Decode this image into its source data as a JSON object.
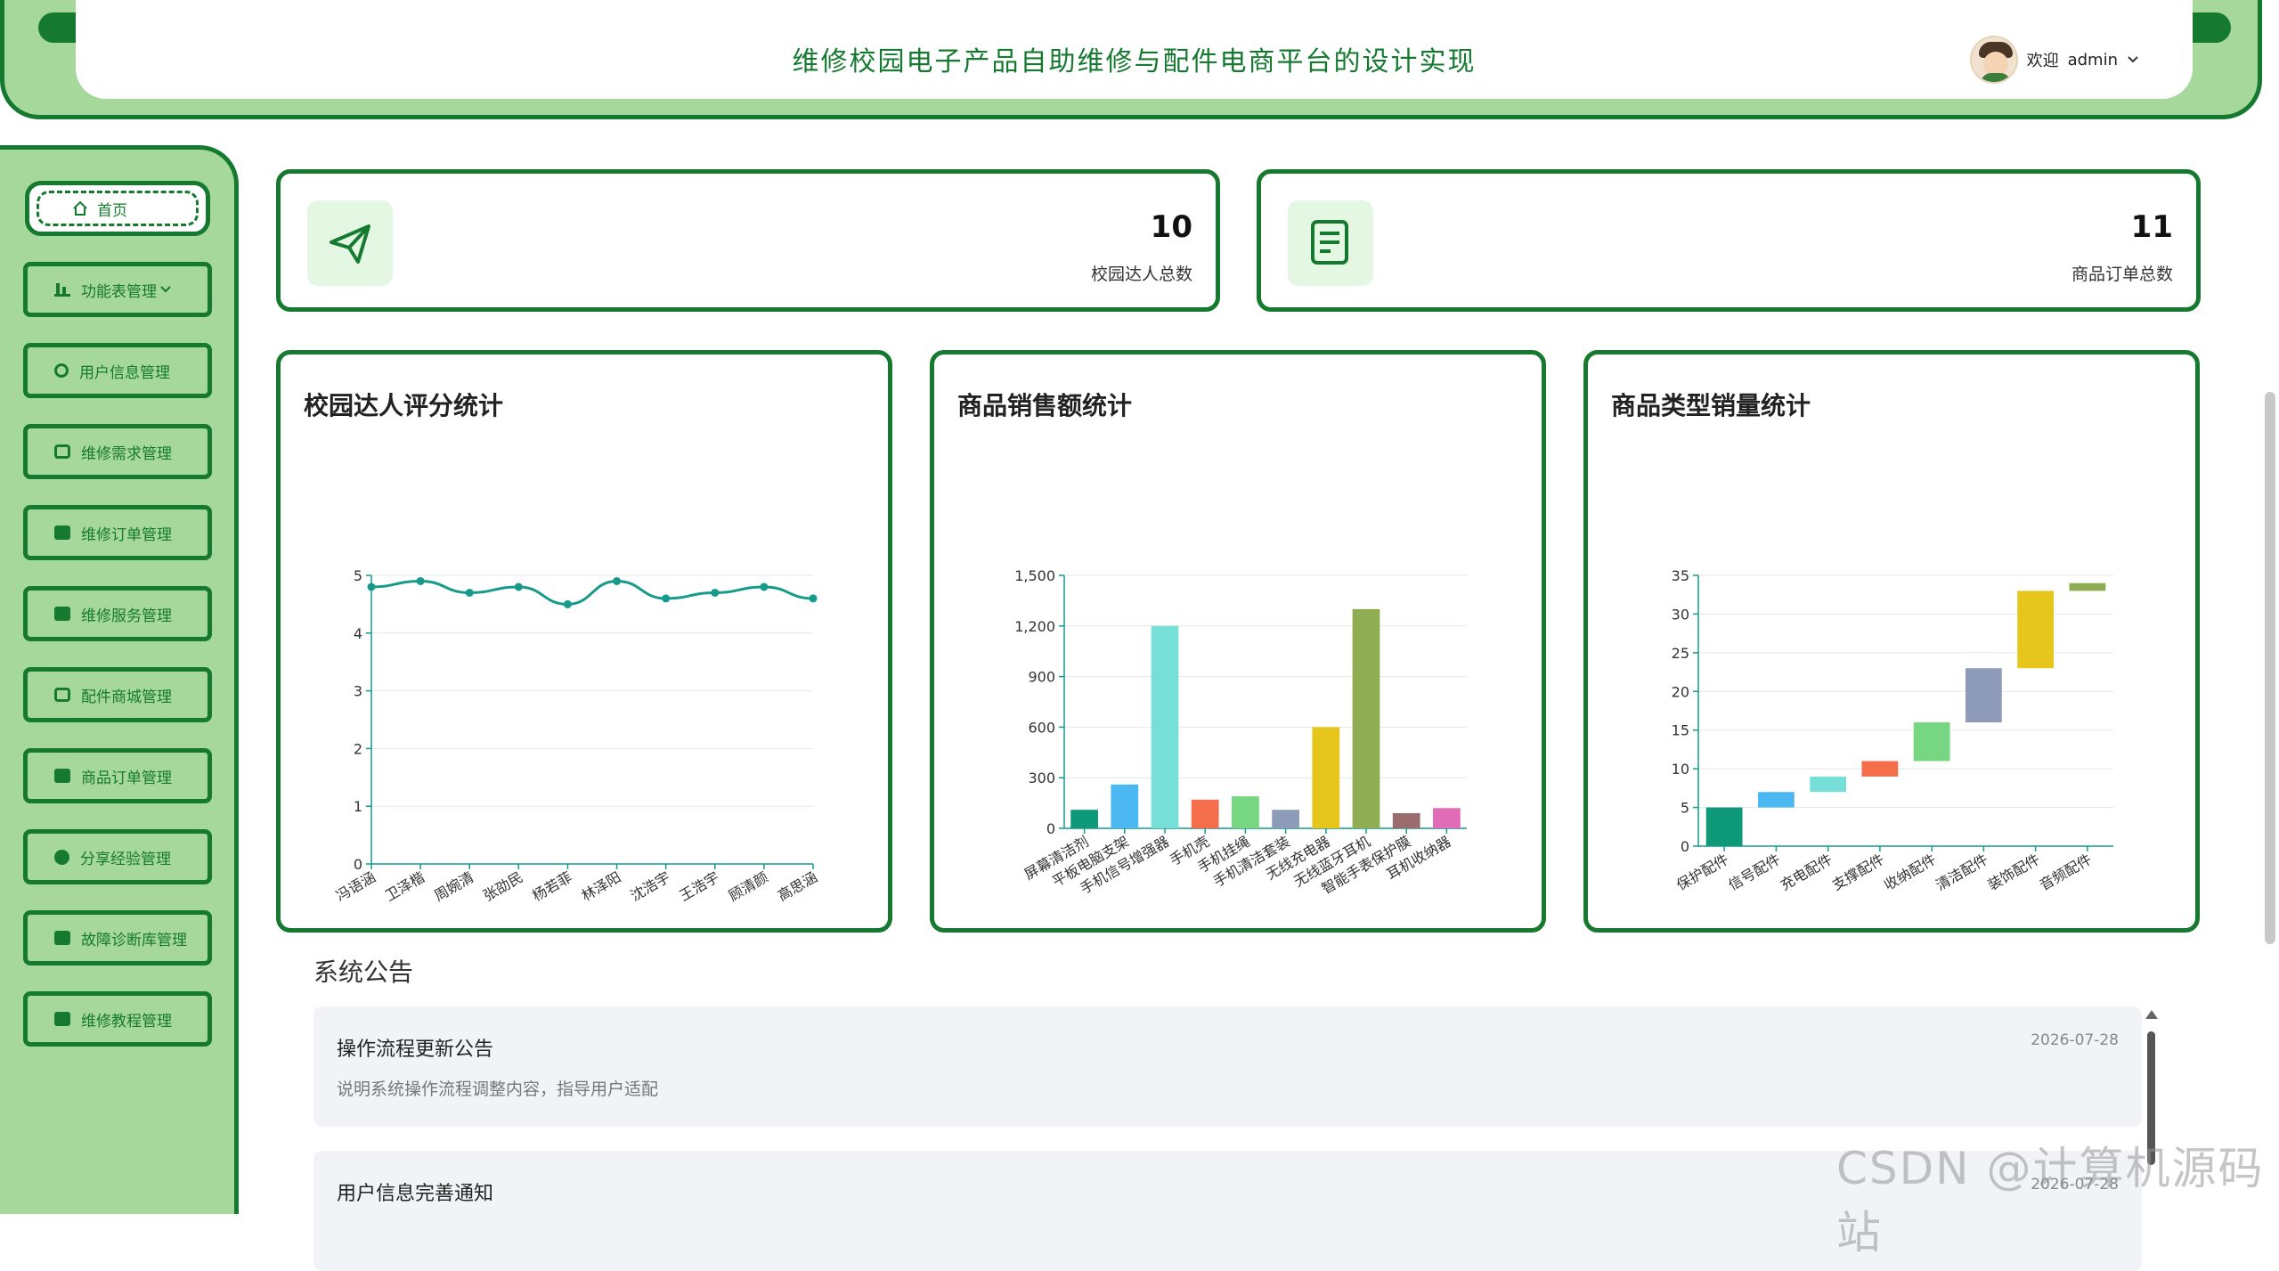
{
  "header": {
    "title": "维修校园电子产品自助维修与配件电商平台的设计实现",
    "welcome": "欢迎",
    "username": "admin"
  },
  "sidebar": {
    "home": "首页",
    "items": [
      {
        "label": "功能表管理",
        "icon": "bar-chart-icon"
      },
      {
        "label": "用户信息管理",
        "icon": "user-icon"
      },
      {
        "label": "维修需求管理",
        "icon": "chip-icon"
      },
      {
        "label": "维修订单管理",
        "icon": "cart-icon"
      },
      {
        "label": "维修服务管理",
        "icon": "folder-icon"
      },
      {
        "label": "配件商城管理",
        "icon": "chip-icon"
      },
      {
        "label": "商品订单管理",
        "icon": "card-icon"
      },
      {
        "label": "分享经验管理",
        "icon": "check-circle-icon"
      },
      {
        "label": "故障诊断库管理",
        "icon": "cart-icon"
      },
      {
        "label": "维修教程管理",
        "icon": "book-icon"
      }
    ]
  },
  "stats": [
    {
      "value": "10",
      "label": "校园达人总数",
      "icon": "send-icon"
    },
    {
      "value": "11",
      "label": "商品订单总数",
      "icon": "document-icon"
    }
  ],
  "chart_titles": [
    "校园达人评分统计",
    "商品销售额统计",
    "商品类型销量统计"
  ],
  "chart_data": [
    {
      "type": "line",
      "title": "校园达人评分统计",
      "categories": [
        "冯语涵",
        "卫泽楷",
        "周婉清",
        "张劭民",
        "杨若菲",
        "林泽阳",
        "沈浩宇",
        "王浩宇",
        "顾清颜",
        "高思涵"
      ],
      "values": [
        4.8,
        4.9,
        4.7,
        4.8,
        4.5,
        4.9,
        4.6,
        4.7,
        4.8,
        4.6
      ],
      "ylim": [
        0,
        5
      ],
      "yticks": [
        "0",
        "1",
        "2",
        "3",
        "4",
        "5"
      ],
      "color": "#159a8c"
    },
    {
      "type": "bar",
      "title": "商品销售额统计",
      "categories": [
        "屏幕清洁剂",
        "平板电脑支架",
        "手机信号增强器",
        "手机壳",
        "手机挂绳",
        "手机清洁套装",
        "无线充电器",
        "无线蓝牙耳机",
        "智能手表保护膜",
        "耳机收纳器"
      ],
      "values": [
        110,
        260,
        1200,
        170,
        190,
        110,
        600,
        1300,
        90,
        120
      ],
      "colors": [
        "#0e9a79",
        "#4cb8f2",
        "#76e0d8",
        "#f56e4c",
        "#76d681",
        "#8e9bb8",
        "#e6c61c",
        "#8fae54",
        "#9a6c6e",
        "#e06bb6"
      ],
      "ylim": [
        0,
        1500
      ],
      "yticks": [
        "0",
        "300",
        "600",
        "900",
        "1,200",
        "1,500"
      ]
    },
    {
      "type": "bar",
      "title": "商品类型销量统计",
      "categories": [
        "保护配件",
        "信号配件",
        "充电配件",
        "支撑配件",
        "收纳配件",
        "清洁配件",
        "装饰配件",
        "音频配件"
      ],
      "ranges": [
        [
          0,
          5
        ],
        [
          5,
          7
        ],
        [
          7,
          9
        ],
        [
          9,
          11
        ],
        [
          11,
          16
        ],
        [
          16,
          23
        ],
        [
          23,
          33
        ],
        [
          33,
          34
        ]
      ],
      "colors": [
        "#0e9a79",
        "#4cb8f2",
        "#76e0d8",
        "#f56e4c",
        "#76d681",
        "#8e9bb8",
        "#e6c61c",
        "#8fae54"
      ],
      "ylim": [
        0,
        35
      ],
      "yticks": [
        "0",
        "5",
        "10",
        "15",
        "20",
        "25",
        "30",
        "35"
      ]
    }
  ],
  "notices": {
    "heading": "系统公告",
    "items": [
      {
        "title": "操作流程更新公告",
        "desc": "说明系统操作流程调整内容，指导用户适配",
        "date": "2026-07-28"
      },
      {
        "title": "用户信息完善通知",
        "desc": "",
        "date": "2026-07-28"
      }
    ]
  },
  "watermark": "CSDN @计算机源码站"
}
